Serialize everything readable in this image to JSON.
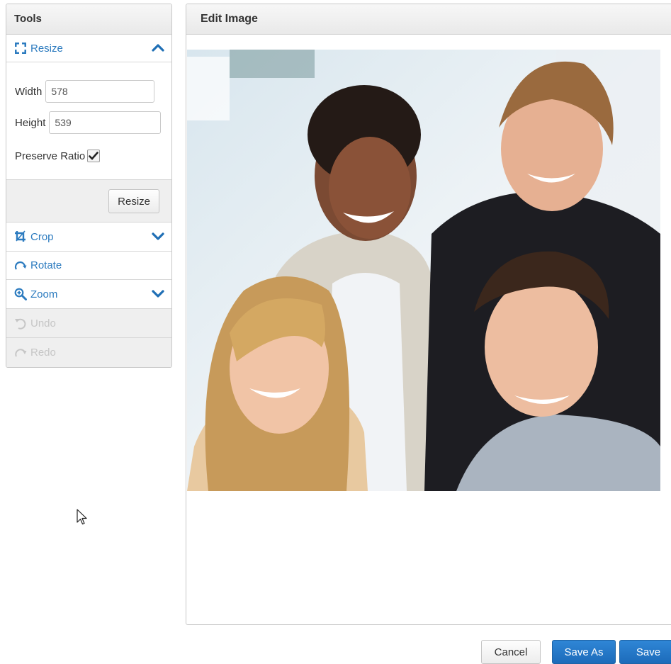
{
  "tools": {
    "header": "Tools",
    "resize": {
      "label": "Resize",
      "width_label": "Width",
      "width_value": "578",
      "height_label": "Height",
      "height_value": "539",
      "preserve_label": "Preserve Ratio",
      "preserve_checked": true,
      "button_label": "Resize"
    },
    "crop_label": "Crop",
    "rotate_label": "Rotate",
    "zoom_label": "Zoom",
    "undo_label": "Undo",
    "redo_label": "Redo"
  },
  "editor": {
    "header": "Edit Image"
  },
  "footer": {
    "cancel_label": "Cancel",
    "save_as_label": "Save As",
    "save_label": "Save"
  },
  "colors": {
    "accent": "#2c7bbf",
    "primary_button": "#2278c8",
    "disabled_text": "#c6c6c6"
  },
  "icons": [
    "resize-icon",
    "chevron-up-icon",
    "crop-icon",
    "chevron-down-icon",
    "rotate-icon",
    "zoom-in-icon",
    "undo-icon",
    "redo-icon",
    "checkmark-icon",
    "mouse-cursor-icon"
  ]
}
